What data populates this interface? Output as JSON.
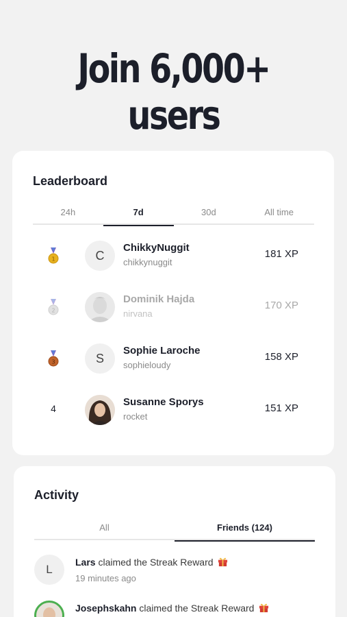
{
  "headline": "Join 6,000+ users",
  "leaderboard": {
    "title": "Leaderboard",
    "tabs": [
      "24h",
      "7d",
      "30d",
      "All time"
    ],
    "active_tab": "7d",
    "rows": [
      {
        "rank": "1",
        "medal": "gold-medal",
        "avatar_initial": "C",
        "name": "ChikkyNuggit",
        "handle": "chikkynuggit",
        "xp": "181 XP"
      },
      {
        "rank": "2",
        "medal": "silver-medal",
        "avatar_initial": "",
        "name": "Dominik Hajda",
        "handle": "nirvana",
        "xp": "170 XP"
      },
      {
        "rank": "3",
        "medal": "bronze-medal",
        "avatar_initial": "S",
        "name": "Sophie Laroche",
        "handle": "sophieloudy",
        "xp": "158 XP"
      },
      {
        "rank": "4",
        "medal": "",
        "avatar_initial": "",
        "name": "Susanne Sporys",
        "handle": "rocket",
        "xp": "151 XP"
      }
    ]
  },
  "activity": {
    "title": "Activity",
    "tabs": [
      "All",
      "Friends (124)"
    ],
    "active_tab": "Friends (124)",
    "items": [
      {
        "avatar_initial": "L",
        "user": "Lars",
        "action": "claimed the Streak Reward",
        "time": "19 minutes ago"
      },
      {
        "avatar_initial": "",
        "user": "Josephskahn",
        "action": "claimed the Streak Reward",
        "time": ""
      }
    ]
  },
  "colors": {
    "background": "#f2f2f2",
    "card": "#ffffff",
    "text": "#1c1f2a",
    "muted": "#8a8a8a",
    "gold": "#e8b21f",
    "bronze": "#c0622a",
    "friend_ring": "#4caf50"
  }
}
